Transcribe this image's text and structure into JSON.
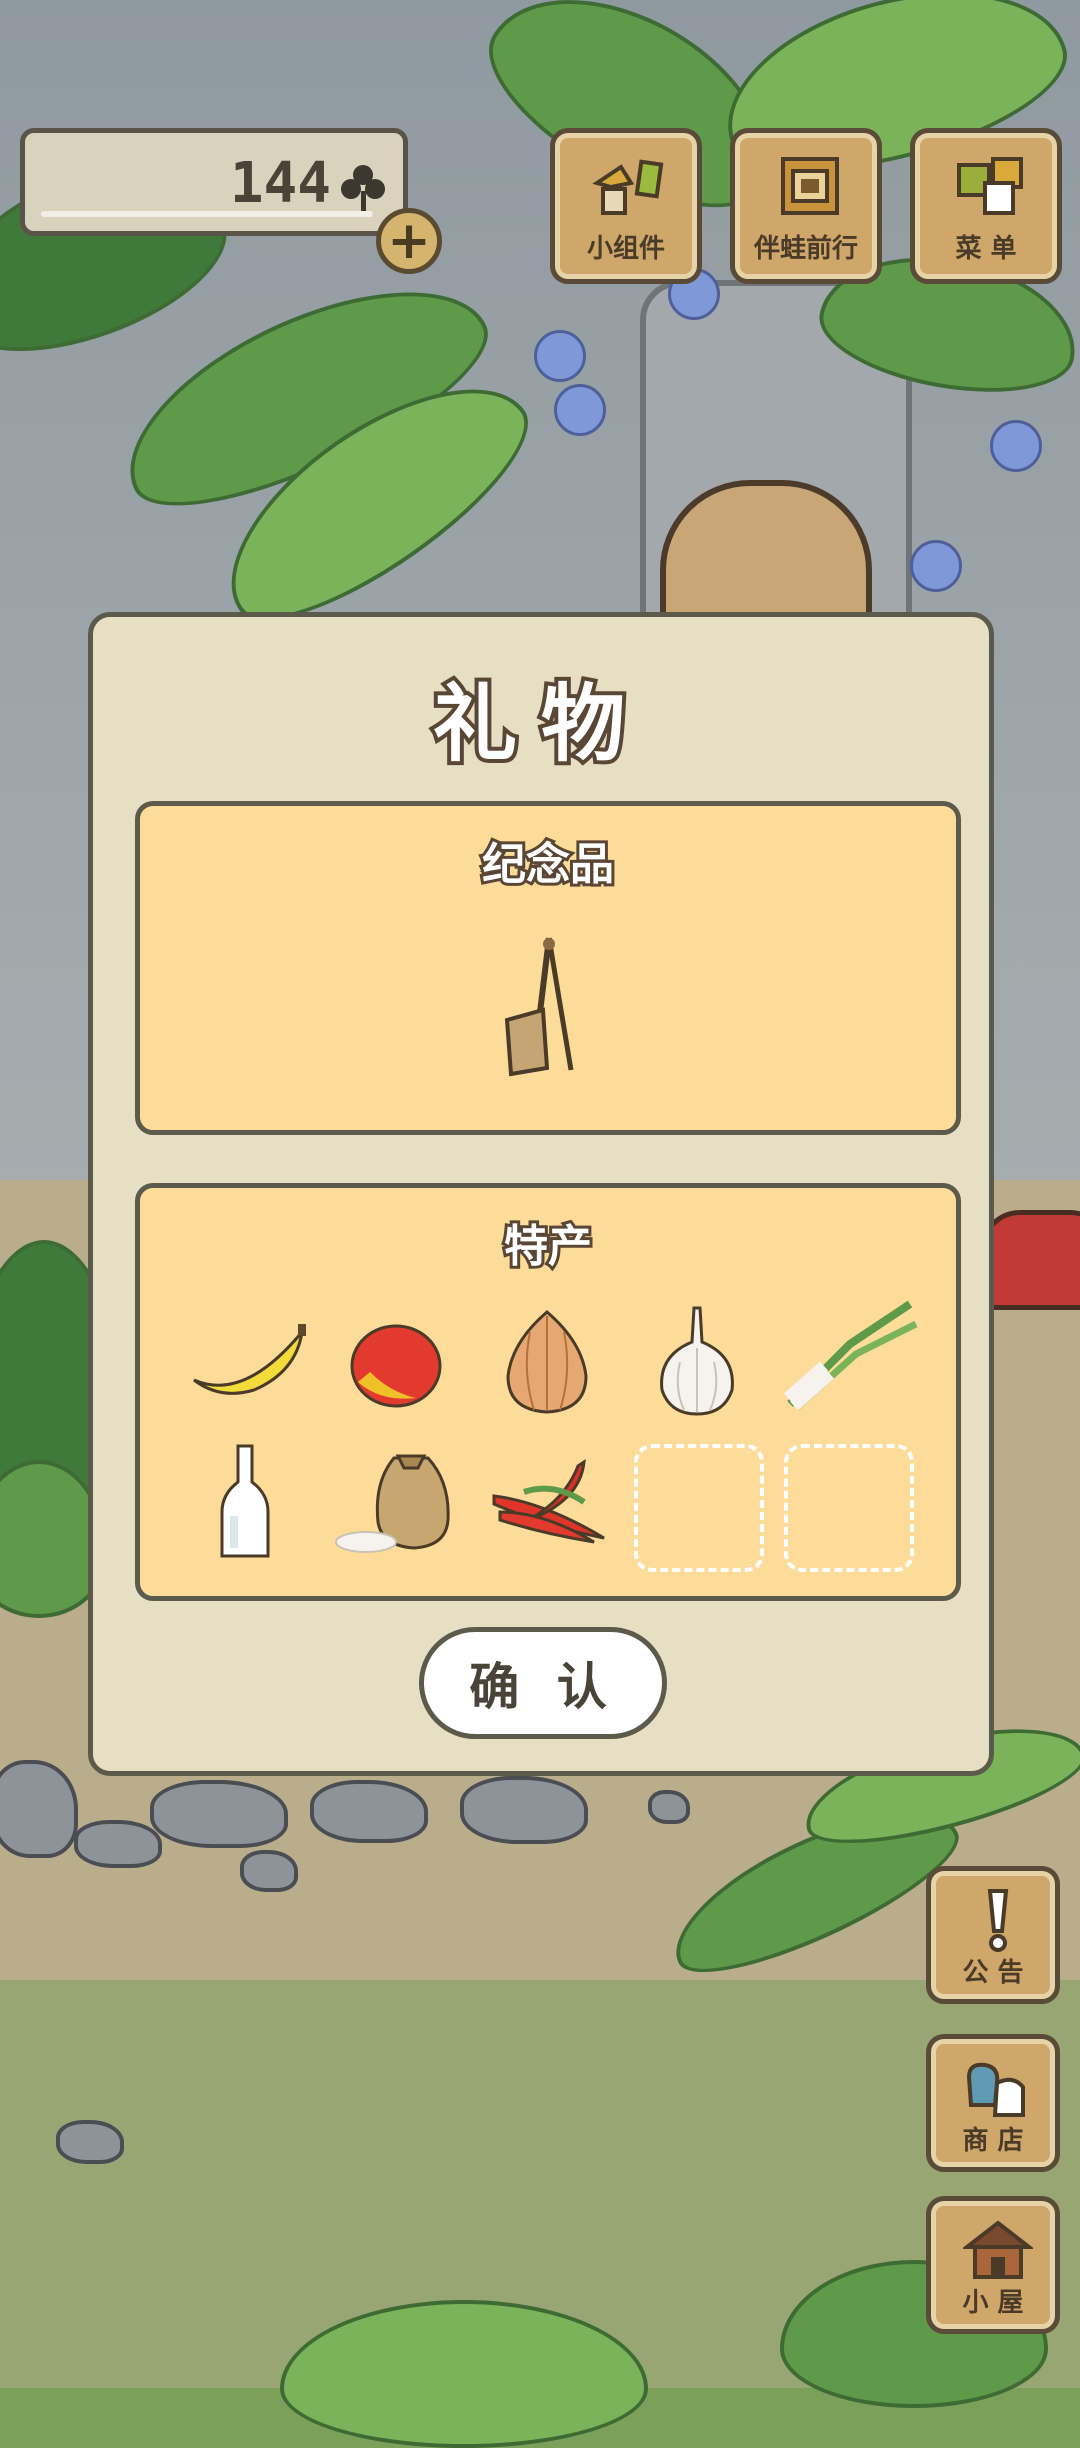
{
  "clovers": {
    "count": "144",
    "icon": "clover-icon",
    "add_icon": "plus-icon"
  },
  "top_buttons": [
    {
      "name": "widgets",
      "label": "小组件",
      "icon": "widget-icon"
    },
    {
      "name": "journey",
      "label": "伴蛙前行",
      "icon": "album-icon"
    },
    {
      "name": "menu",
      "label": "菜 单",
      "icon": "menu-icon"
    }
  ],
  "side_buttons": [
    {
      "name": "notice",
      "label": "公 告",
      "icon": "exclamation-icon"
    },
    {
      "name": "shop",
      "label": "商 店",
      "icon": "shop-bag-icon"
    },
    {
      "name": "house",
      "label": "小 屋",
      "icon": "house-icon"
    }
  ],
  "dialog": {
    "title": "礼物",
    "souvenir": {
      "title": "纪念品",
      "items": [
        "lute-icon"
      ]
    },
    "specialty": {
      "title": "特产",
      "items": [
        "banana-icon",
        "mango-icon",
        "onion-icon",
        "garlic-icon",
        "scallion-icon",
        "bottle-icon",
        "rice-sack-icon",
        "chili-icon"
      ],
      "empty_slots": 2
    },
    "confirm_label": "确 认"
  },
  "colors": {
    "panel": "#fddc99",
    "dialog": "#e7dfc3",
    "wood": "#cfa76a",
    "outline": "#5c5a4a"
  }
}
